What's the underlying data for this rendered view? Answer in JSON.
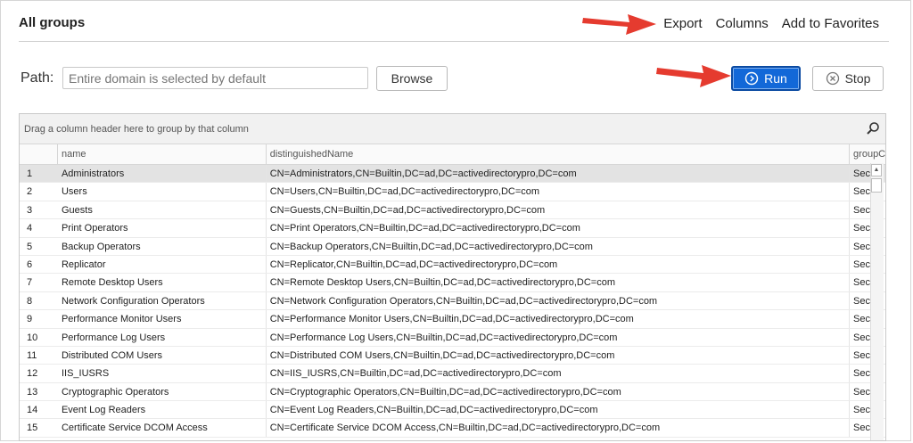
{
  "header": {
    "title": "All groups",
    "actions": [
      "Export",
      "Columns",
      "Add to Favorites"
    ]
  },
  "path": {
    "label": "Path:",
    "placeholder": "Entire domain is selected by default",
    "value": ""
  },
  "buttons": {
    "browse": "Browse",
    "run": "Run",
    "stop": "Stop"
  },
  "grid": {
    "group_hint": "Drag a column header here to group by that column",
    "columns": [
      "",
      "name",
      "distinguishedName",
      "groupCa"
    ],
    "rows": [
      {
        "idx": "1",
        "name": "Administrators",
        "dn": "CN=Administrators,CN=Builtin,DC=ad,DC=activedirectorypro,DC=com",
        "grp": "Secu"
      },
      {
        "idx": "2",
        "name": "Users",
        "dn": "CN=Users,CN=Builtin,DC=ad,DC=activedirectorypro,DC=com",
        "grp": "Secu"
      },
      {
        "idx": "3",
        "name": "Guests",
        "dn": "CN=Guests,CN=Builtin,DC=ad,DC=activedirectorypro,DC=com",
        "grp": "Secu"
      },
      {
        "idx": "4",
        "name": "Print Operators",
        "dn": "CN=Print Operators,CN=Builtin,DC=ad,DC=activedirectorypro,DC=com",
        "grp": "Secu"
      },
      {
        "idx": "5",
        "name": "Backup Operators",
        "dn": "CN=Backup Operators,CN=Builtin,DC=ad,DC=activedirectorypro,DC=com",
        "grp": "Secu"
      },
      {
        "idx": "6",
        "name": "Replicator",
        "dn": "CN=Replicator,CN=Builtin,DC=ad,DC=activedirectorypro,DC=com",
        "grp": "Secu"
      },
      {
        "idx": "7",
        "name": "Remote Desktop Users",
        "dn": "CN=Remote Desktop Users,CN=Builtin,DC=ad,DC=activedirectorypro,DC=com",
        "grp": "Secu"
      },
      {
        "idx": "8",
        "name": "Network Configuration Operators",
        "dn": "CN=Network Configuration Operators,CN=Builtin,DC=ad,DC=activedirectorypro,DC=com",
        "grp": "Secu"
      },
      {
        "idx": "9",
        "name": "Performance Monitor Users",
        "dn": "CN=Performance Monitor Users,CN=Builtin,DC=ad,DC=activedirectorypro,DC=com",
        "grp": "Secu"
      },
      {
        "idx": "10",
        "name": "Performance Log Users",
        "dn": "CN=Performance Log Users,CN=Builtin,DC=ad,DC=activedirectorypro,DC=com",
        "grp": "Secu"
      },
      {
        "idx": "11",
        "name": "Distributed COM Users",
        "dn": "CN=Distributed COM Users,CN=Builtin,DC=ad,DC=activedirectorypro,DC=com",
        "grp": "Secu"
      },
      {
        "idx": "12",
        "name": "IIS_IUSRS",
        "dn": "CN=IIS_IUSRS,CN=Builtin,DC=ad,DC=activedirectorypro,DC=com",
        "grp": "Secu"
      },
      {
        "idx": "13",
        "name": "Cryptographic Operators",
        "dn": "CN=Cryptographic Operators,CN=Builtin,DC=ad,DC=activedirectorypro,DC=com",
        "grp": "Secu"
      },
      {
        "idx": "14",
        "name": "Event Log Readers",
        "dn": "CN=Event Log Readers,CN=Builtin,DC=ad,DC=activedirectorypro,DC=com",
        "grp": "Secu"
      },
      {
        "idx": "15",
        "name": "Certificate Service DCOM Access",
        "dn": "CN=Certificate Service DCOM Access,CN=Builtin,DC=ad,DC=activedirectorypro,DC=com",
        "grp": "Secu"
      }
    ]
  },
  "icons": {
    "run": "play-circle-icon",
    "stop": "stop-circle-icon",
    "search": "search-icon",
    "annotation": "red-arrow-icon"
  },
  "colors": {
    "run_button": "#1268d8",
    "annotation_arrow": "#e53b2f"
  }
}
